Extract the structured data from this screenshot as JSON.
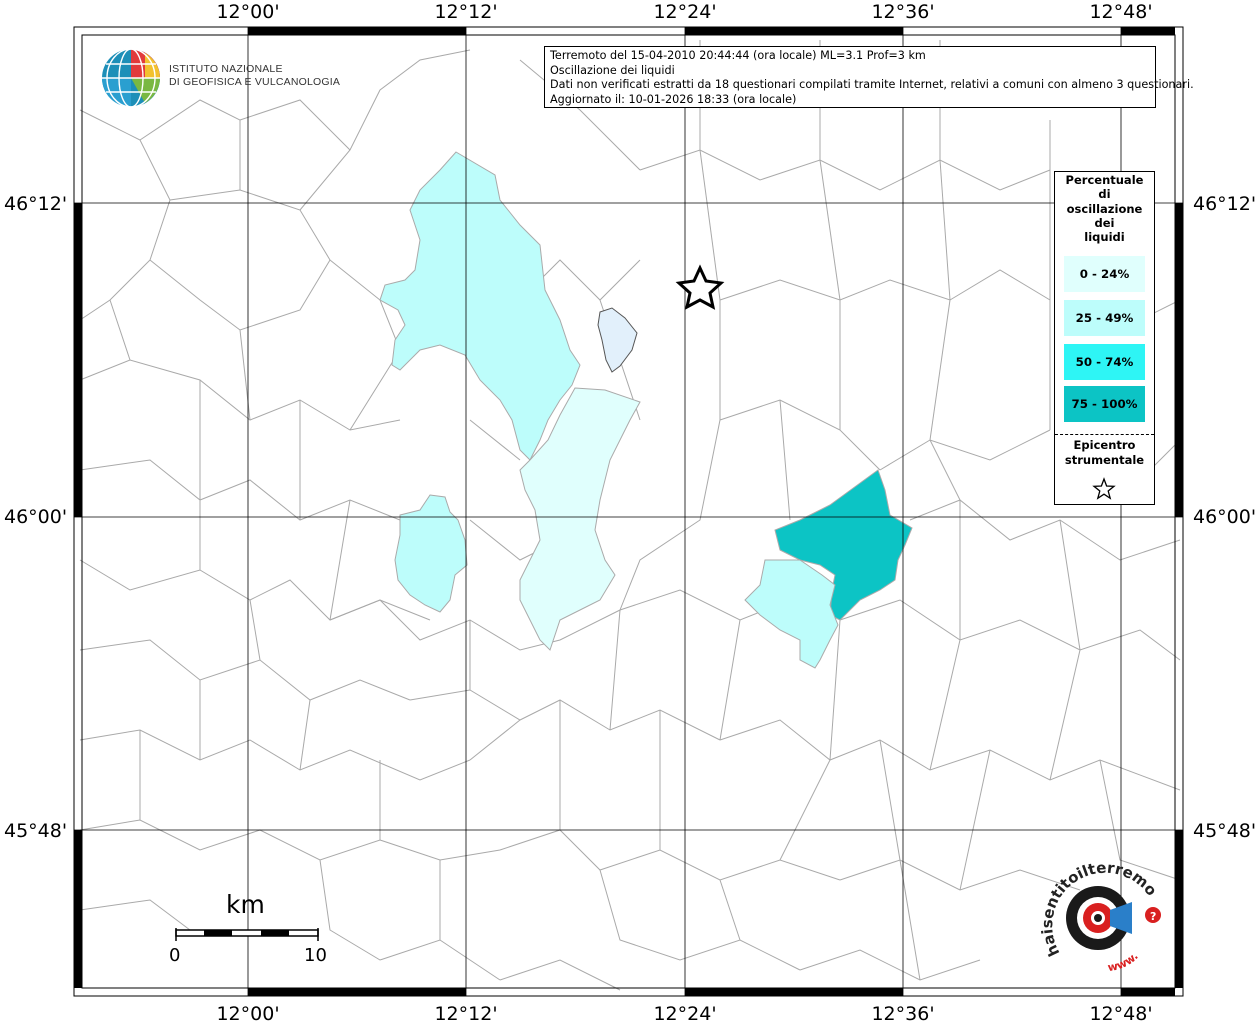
{
  "map": {
    "lon_labels": [
      "12°00'",
      "12°12'",
      "12°24'",
      "12°36'",
      "12°48'"
    ],
    "lat_labels": [
      "46°12'",
      "46°00'",
      "45°48'"
    ]
  },
  "info": {
    "line1": "Terremoto del 15-04-2010 20:44:44 (ora locale) ML=3.1 Prof=3 km",
    "line2": "Oscillazione dei liquidi",
    "line3": "Dati non verificati estratti da 18 questionari compilati tramite Internet, relativi a comuni con almeno 3 questionari.",
    "line4": "Aggiornato il: 10-01-2026 18:33 (ora locale)"
  },
  "legend": {
    "title_lines": [
      "Percentuale",
      "di",
      "oscillazione",
      "dei",
      "liquidi"
    ],
    "items": [
      {
        "label": "0 - 24%",
        "color": "#e0fffd"
      },
      {
        "label": "25 - 49%",
        "color": "#bdfdfb"
      },
      {
        "label": "50 - 74%",
        "color": "#2ef5f5"
      },
      {
        "label": "75 - 100%",
        "color": "#0cc4c5"
      }
    ],
    "epicenter_lines": [
      "Epicentro",
      "strumentale"
    ],
    "epicenter_icon": "star-outline-icon"
  },
  "logo": {
    "institute_line1": "ISTITUTO NAZIONALE",
    "institute_line2": "DI GEOFISICA E VULCANOLOGIA",
    "hsit_text": "haisentitoilterremoto.it",
    "hsit_www": "www."
  },
  "scale": {
    "unit": "km",
    "start": "0",
    "end": "10"
  },
  "colors": {
    "lake": "#e2f0fb",
    "boundary": "#999999",
    "grid": "#000000"
  }
}
